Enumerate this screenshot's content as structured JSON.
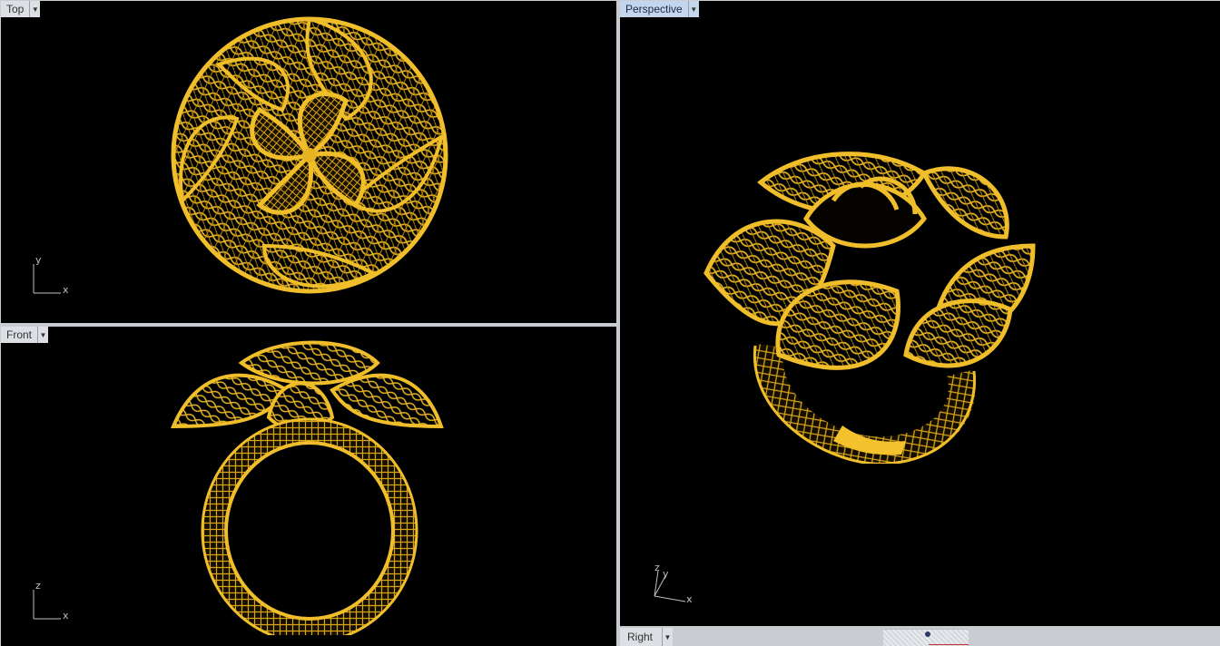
{
  "viewports": {
    "top": {
      "label": "Top",
      "axis_x": "x",
      "axis_y": "y"
    },
    "front": {
      "label": "Front",
      "axis_x": "x",
      "axis_y": "z"
    },
    "perspective": {
      "label": "Perspective",
      "axis_x": "x",
      "axis_y": "y",
      "axis_z": "z"
    },
    "right": {
      "label": "Right"
    }
  },
  "icons": {
    "dropdown": "chevron-down-icon"
  },
  "colors": {
    "viewport_bg": "#000000",
    "gold": "#e6b422",
    "gold_dark": "#8a6208",
    "active_tab": "#c3d6ee"
  }
}
